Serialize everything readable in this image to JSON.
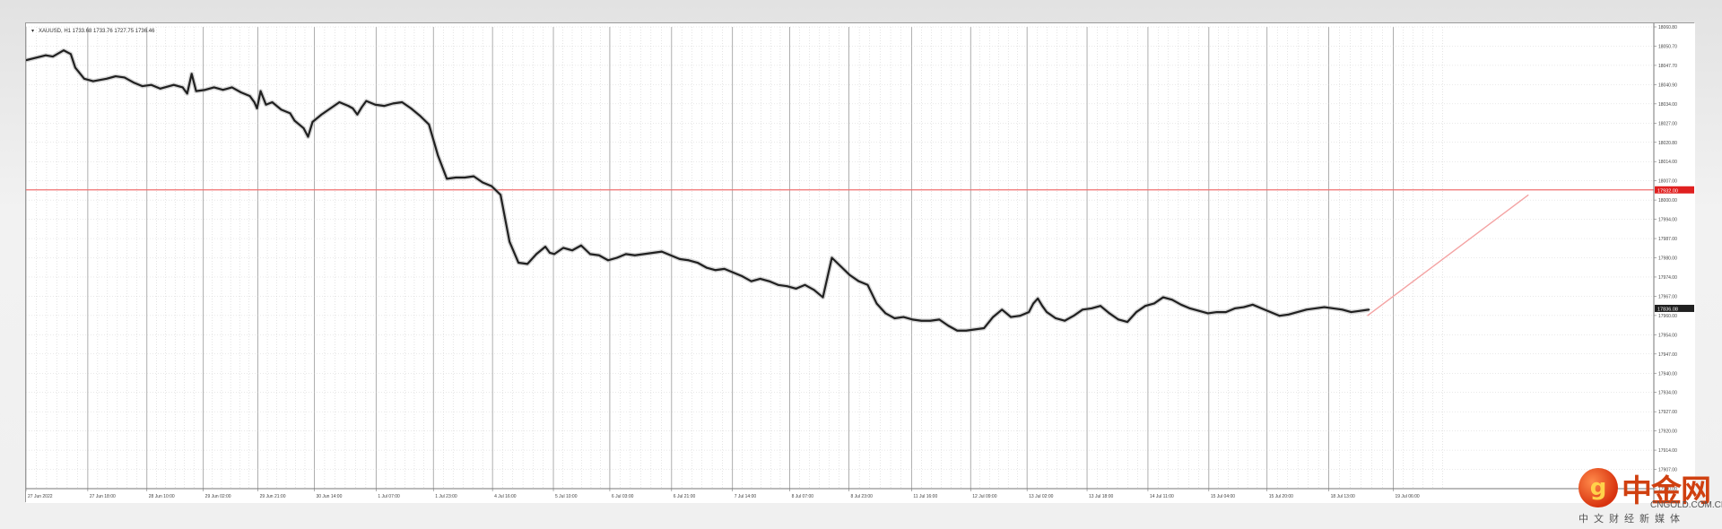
{
  "window": {
    "info_line": "XAUUSD, H1  1733.68 1733.76 1727.75 1736.46"
  },
  "watermark": {
    "brand": "中金网",
    "domain": "CNGOLD.COM.CN",
    "subtitle": "中文财经新媒体",
    "logo_glyph": "g"
  },
  "colors": {
    "background": "#ffffff",
    "grid": "#c8c8c8",
    "candle": "#202020",
    "wick_light": "#b0b0b0",
    "hline": "#f07070",
    "trendline": "#f4a3a3",
    "price_tag": "#e02020",
    "current_tag": "#202020"
  },
  "chart_data": {
    "type": "line",
    "symbol": "XAUUSD, H1",
    "ylim": [
      17690.0,
      18064.0
    ],
    "y_ticks": [
      "18060.80",
      "18050.70",
      "18047.70",
      "18040.90",
      "18034.00",
      "18027.00",
      "18020.80",
      "18014.00",
      "18007.00",
      "18000.00",
      "17994.00",
      "17987.00",
      "17980.00",
      "17974.00",
      "17967.00",
      "17960.00",
      "17954.00",
      "17947.00",
      "17940.00",
      "17934.00",
      "17927.00",
      "17920.00",
      "17914.00",
      "17907.00",
      "17900.00"
    ],
    "x_ticks": [
      "27 Jun 2022",
      "27 Jun 18:00",
      "28 Jun 10:00",
      "29 Jun 02:00",
      "29 Jun 21:00",
      "30 Jun 14:00",
      "1 Jul 07:00",
      "1 Jul 23:00",
      "4 Jul 16:00",
      "5 Jul 10:00",
      "6 Jul 03:00",
      "6 Jul 21:00",
      "7 Jul 14:00",
      "8 Jul 07:00",
      "8 Jul 23:00",
      "11 Jul 16:00",
      "12 Jul 09:00",
      "13 Jul 02:00",
      "13 Jul 18:00",
      "14 Jul 11:00",
      "15 Jul 04:00",
      "15 Jul 20:00",
      "18 Jul 13:00",
      "19 Jul 06:00"
    ],
    "x_tick_nums": [
      0,
      69,
      135,
      198,
      259,
      322,
      391,
      455,
      521,
      589,
      652,
      721,
      789,
      853,
      919,
      989,
      1055,
      1118,
      1185,
      1253,
      1321,
      1386,
      1455,
      1527
    ],
    "hline": {
      "value": 17932.0,
      "label": "17932.00"
    },
    "current_price": {
      "value": 17836.0,
      "label": "17836.08"
    },
    "trendline": {
      "x1": 1498,
      "y1": 17830.0,
      "x2": 1678,
      "y2": 17928.0
    },
    "x": [
      0,
      22,
      30,
      42,
      50,
      55,
      65,
      75,
      90,
      100,
      110,
      120,
      130,
      140,
      150,
      165,
      175,
      180,
      185,
      190,
      200,
      210,
      220,
      230,
      240,
      250,
      255,
      258,
      262,
      268,
      275,
      285,
      295,
      300,
      310,
      315,
      320,
      330,
      340,
      350,
      360,
      365,
      370,
      375,
      380,
      390,
      400,
      410,
      420,
      430,
      440,
      450,
      460,
      470,
      480,
      490,
      500,
      510,
      520,
      530,
      540,
      550,
      560,
      570,
      580,
      585,
      590,
      600,
      610,
      620,
      630,
      640,
      650,
      660,
      670,
      680,
      700,
      710,
      720,
      730,
      740,
      750,
      760,
      770,
      780,
      790,
      800,
      810,
      820,
      830,
      840,
      850,
      860,
      870,
      880,
      890,
      900,
      910,
      920,
      930,
      940,
      950,
      960,
      970,
      980,
      990,
      1000,
      1010,
      1020,
      1030,
      1040,
      1050,
      1060,
      1070,
      1080,
      1090,
      1100,
      1110,
      1120,
      1125,
      1130,
      1135,
      1140,
      1150,
      1160,
      1170,
      1180,
      1190,
      1200,
      1210,
      1220,
      1230,
      1240,
      1250,
      1260,
      1270,
      1280,
      1290,
      1300,
      1310,
      1320,
      1330,
      1340,
      1350,
      1360,
      1370,
      1380,
      1390,
      1400,
      1410,
      1420,
      1430,
      1440,
      1450,
      1460,
      1470,
      1480,
      1490,
      1500
    ],
    "y": [
      18037,
      18041,
      18040,
      18045,
      18042,
      18031,
      18022,
      18020,
      18022,
      18024,
      18023,
      18019,
      18016,
      18017,
      18014,
      18017,
      18015,
      18010,
      18026,
      18012,
      18013,
      18015,
      18013,
      18015,
      18011,
      18008,
      18003,
      17998,
      18012,
      18001,
      18003,
      17997,
      17994,
      17988,
      17982,
      17975,
      17987,
      17993,
      17998,
      18003,
      18000,
      17998,
      17993,
      17999,
      18004,
      18001,
      18000,
      18002,
      18003,
      17998,
      17992,
      17985,
      17960,
      17941,
      17942,
      17942,
      17943,
      17938,
      17935,
      17928,
      17890,
      17873,
      17872,
      17880,
      17886,
      17881,
      17880,
      17885,
      17883,
      17887,
      17880,
      17879,
      17875,
      17877,
      17880,
      17879,
      17881,
      17882,
      17879,
      17876,
      17875,
      17873,
      17869,
      17867,
      17868,
      17865,
      17862,
      17858,
      17860,
      17858,
      17855,
      17854,
      17852,
      17855,
      17851,
      17845,
      17877,
      17870,
      17863,
      17858,
      17855,
      17840,
      17832,
      17828,
      17829,
      17827,
      17826,
      17826,
      17827,
      17822,
      17818,
      17818,
      17819,
      17820,
      17829,
      17835,
      17829,
      17830,
      17833,
      17840,
      17844,
      17838,
      17833,
      17828,
      17826,
      17830,
      17835,
      17836,
      17838,
      17832,
      17827,
      17825,
      17833,
      17838,
      17840,
      17845,
      17843,
      17839,
      17836,
      17834,
      17832,
      17833,
      17833,
      17836,
      17837,
      17839,
      17836,
      17833,
      17830,
      17831,
      17833,
      17835,
      17836,
      17837,
      17836,
      17835,
      17833,
      17834,
      17835,
      17836,
      17836
    ]
  }
}
